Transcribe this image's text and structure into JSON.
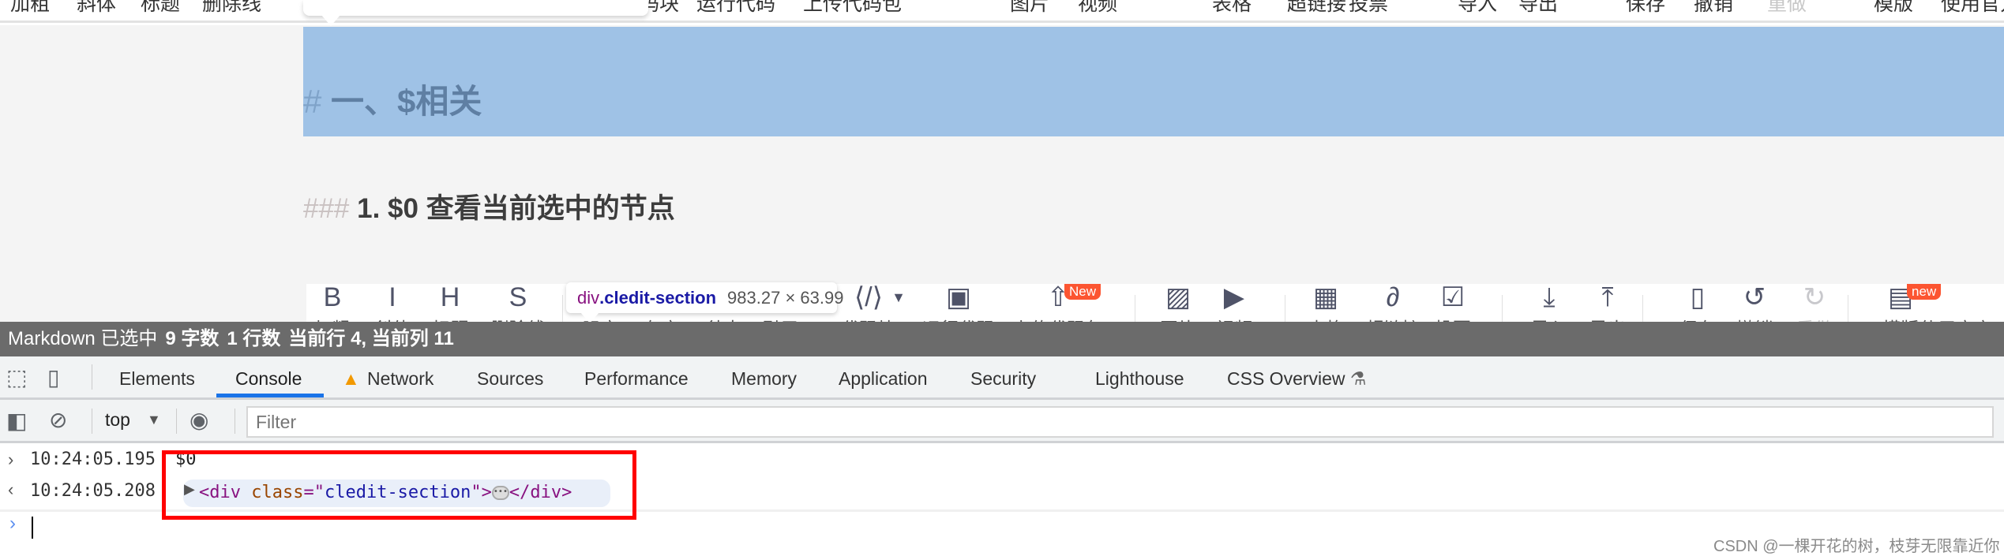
{
  "menubar": {
    "items": [
      {
        "label": "加粗"
      },
      {
        "label": "斜体"
      },
      {
        "label": "标题"
      },
      {
        "label": "删除线"
      },
      {
        "label": "代码块"
      },
      {
        "label": "运行代码"
      },
      {
        "label": "上传代码包"
      },
      {
        "label": "图片"
      },
      {
        "label": "视频"
      },
      {
        "label": "表格"
      },
      {
        "label": "超链接"
      },
      {
        "label": "投票"
      },
      {
        "label": "导入"
      },
      {
        "label": "导出"
      },
      {
        "label": "保存"
      },
      {
        "label": "撤销"
      },
      {
        "label": "重做",
        "disabled": true
      },
      {
        "label": "模版"
      },
      {
        "label": "使用官方"
      }
    ]
  },
  "editor": {
    "h1_hash": "#",
    "h1_text": "一、$相关",
    "h3_hash": "###",
    "h3_text": "1. $0 查看当前选中的节点"
  },
  "toolbar": {
    "items": [
      {
        "icon": "bold-icon",
        "glyph": "B",
        "label": "加粗"
      },
      {
        "icon": "italic-icon",
        "glyph": "I",
        "label": "斜体"
      },
      {
        "icon": "heading-icon",
        "glyph": "H",
        "label": "标题"
      },
      {
        "icon": "strikethrough-icon",
        "glyph": "S",
        "label": "删除线"
      },
      {
        "icon": "unordered-list-icon",
        "glyph": "",
        "label": "无序"
      },
      {
        "icon": "ordered-list-icon",
        "glyph": "",
        "label": "有序"
      },
      {
        "icon": "todo-icon",
        "glyph": "",
        "label": "待办"
      },
      {
        "icon": "quote-icon",
        "glyph": "",
        "label": "引用"
      },
      {
        "icon": "code-block-icon",
        "glyph": "⟨/⟩",
        "label": "代码块"
      },
      {
        "icon": "run-code-icon",
        "glyph": "▣",
        "label": "运行代码"
      },
      {
        "icon": "upload-code-icon",
        "glyph": "⇧",
        "label": "上传代码包",
        "badge": "New"
      },
      {
        "icon": "image-icon",
        "glyph": "▨",
        "label": "图片"
      },
      {
        "icon": "video-icon",
        "glyph": "▶",
        "label": "视频"
      },
      {
        "icon": "table-icon",
        "glyph": "▦",
        "label": "表格"
      },
      {
        "icon": "link-icon",
        "glyph": "∂",
        "label": "超链接"
      },
      {
        "icon": "vote-icon",
        "glyph": "☑",
        "label": "投票"
      },
      {
        "icon": "import-icon",
        "glyph": "⤓",
        "label": "导入"
      },
      {
        "icon": "export-icon",
        "glyph": "⤒",
        "label": "导出"
      },
      {
        "icon": "save-icon",
        "glyph": "▯",
        "label": "保存"
      },
      {
        "icon": "undo-icon",
        "glyph": "↺",
        "label": "撤销"
      },
      {
        "icon": "redo-icon",
        "glyph": "↻",
        "label": "重做",
        "disabled": true
      },
      {
        "icon": "template-icon",
        "glyph": "▤",
        "label": "模版",
        "badge": "new"
      },
      {
        "icon": "",
        "glyph": "",
        "label": "使用官方"
      }
    ]
  },
  "inspect_tooltip": {
    "tag": "div",
    "class": ".cledit-section",
    "size": "983.27 × 63.99"
  },
  "statusbar": {
    "mode": "Markdown 已选中",
    "chars": "9 字数",
    "lines": "1 行数",
    "position": "当前行 4, 当前列 11"
  },
  "devtools": {
    "tabs": [
      {
        "label": "Elements"
      },
      {
        "label": "Console",
        "active": true
      },
      {
        "label": "Network",
        "warning": true
      },
      {
        "label": "Sources"
      },
      {
        "label": "Performance"
      },
      {
        "label": "Memory"
      },
      {
        "label": "Application"
      },
      {
        "label": "Security"
      },
      {
        "label": "Lighthouse"
      },
      {
        "label": "CSS Overview",
        "experimental": true
      }
    ],
    "context": "top",
    "filter_placeholder": "Filter",
    "accent": "#1a73e8",
    "warning_color": "#f29900"
  },
  "console": {
    "input_time": "10:24:05.195",
    "input_cmd": "$0",
    "output_time": "10:24:05.208",
    "node_open": "<div ",
    "node_attr": "class",
    "node_eq": "=\"",
    "node_value": "cledit-section",
    "node_close": "\">",
    "node_end": "</div>",
    "highlight_color": "#ff0000"
  },
  "watermark": "CSDN @一棵开花的树，枝芽无限靠近你"
}
